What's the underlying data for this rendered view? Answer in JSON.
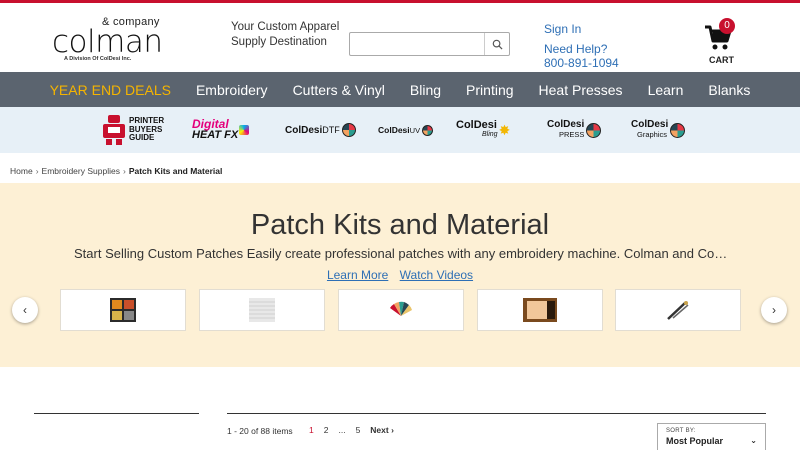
{
  "header": {
    "logo": {
      "company": "& company",
      "name": "colman",
      "division": "A Division Of ColDesi Inc."
    },
    "tagline": "Your Custom Apparel Supply Destination",
    "search": {
      "value": "",
      "placeholder": ""
    },
    "sign_in": "Sign In",
    "need_help": "Need Help?",
    "phone": "800-891-1094",
    "cart": {
      "count": "0",
      "label": "CART"
    }
  },
  "nav": {
    "items": [
      "YEAR END DEALS",
      "Embroidery",
      "Cutters & Vinyl",
      "Bling",
      "Printing",
      "Heat Presses",
      "Learn",
      "Blanks"
    ],
    "deal_color": "#f5b400",
    "bar_color": "#5b646f"
  },
  "brands": {
    "printer_buyers_guide": [
      "PRINTER",
      "BUYERS",
      "GUIDE"
    ],
    "digital_heat_fx": {
      "line1": "Digital",
      "line2": "HEAT FX"
    },
    "coldesi_dtf": {
      "name": "ColDesi",
      "suffix": "DTF"
    },
    "coldesi_uv": {
      "name": "ColDesi",
      "suffix": "UV"
    },
    "coldesi_bling": {
      "name": "ColDesi",
      "suffix": "Bling"
    },
    "coldesi_press": {
      "name": "ColDesi",
      "suffix": "PRESS"
    },
    "coldesi_graphics": {
      "name": "ColDesi",
      "suffix": "Graphics"
    }
  },
  "breadcrumb": {
    "items": [
      "Home",
      "Embroidery Supplies",
      "Patch Kits and Material"
    ],
    "separator": "›"
  },
  "hero": {
    "title": "Patch Kits and Material",
    "description": "Start Selling Custom Patches Easily create professional patches with any embroidery machine. Colman and Compa…",
    "learn_more": "Learn More",
    "watch_videos": "Watch Videos",
    "background": "#fdf0d5",
    "carousel_items": [
      "patch-kit-box",
      "patch-material-swatch",
      "thread-color-fan",
      "patch-backing-sheet",
      "patch-tool"
    ]
  },
  "listing": {
    "count_text": "1 - 20 of 88 items",
    "pages": [
      "1",
      "2",
      "...",
      "5"
    ],
    "current_page": "1",
    "next_label": "Next ›",
    "sort_label": "SORT BY:",
    "sort_value": "Most Popular"
  },
  "colors": {
    "accent": "#c8102e",
    "link": "#2e6fb5"
  }
}
